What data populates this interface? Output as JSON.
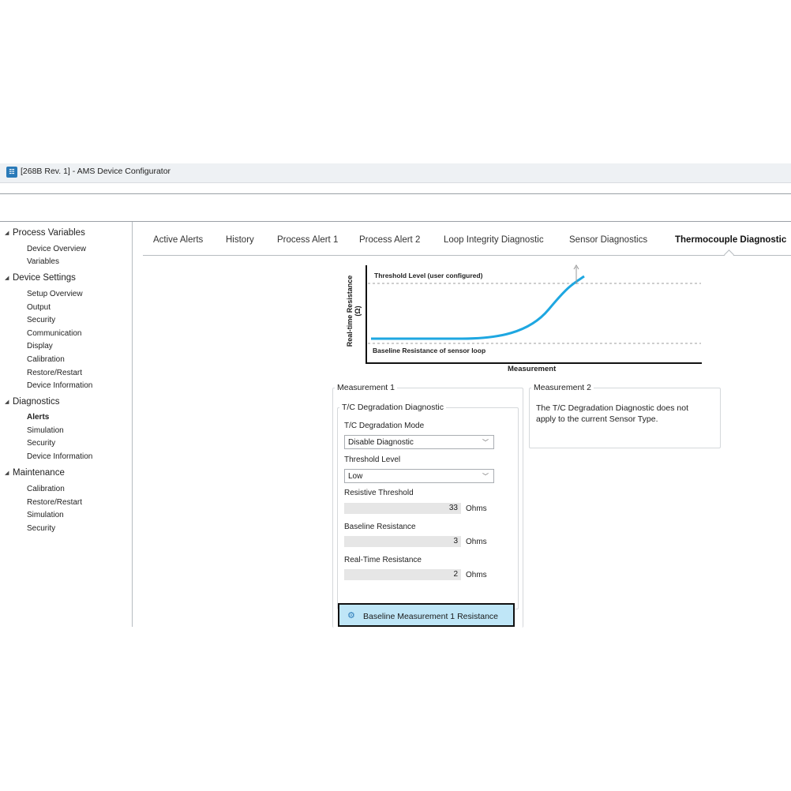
{
  "window": {
    "title": "[268B  Rev. 1] - AMS Device Configurator",
    "icon_name": "ams-app-icon",
    "icon_glyph": "☷"
  },
  "sidebar": {
    "groups": [
      {
        "label": "Process Variables",
        "items": [
          {
            "label": "Device Overview"
          },
          {
            "label": "Variables"
          }
        ]
      },
      {
        "label": "Device Settings",
        "items": [
          {
            "label": "Setup Overview"
          },
          {
            "label": "Output"
          },
          {
            "label": "Security"
          },
          {
            "label": "Communication"
          },
          {
            "label": "Display"
          },
          {
            "label": "Calibration"
          },
          {
            "label": "Restore/Restart"
          },
          {
            "label": "Device Information"
          }
        ]
      },
      {
        "label": "Diagnostics",
        "items": [
          {
            "label": "Alerts",
            "selected": true
          },
          {
            "label": "Simulation"
          },
          {
            "label": "Security"
          },
          {
            "label": "Device Information"
          }
        ]
      },
      {
        "label": "Maintenance",
        "items": [
          {
            "label": "Calibration"
          },
          {
            "label": "Restore/Restart"
          },
          {
            "label": "Simulation"
          },
          {
            "label": "Security"
          }
        ]
      }
    ]
  },
  "tabs": [
    {
      "label": "Active Alerts"
    },
    {
      "label": "History"
    },
    {
      "label": "Process Alert 1"
    },
    {
      "label": "Process Alert 2"
    },
    {
      "label": "Loop Integrity Diagnostic"
    },
    {
      "label": "Sensor Diagnostics"
    },
    {
      "label": "Thermocouple Diagnostic",
      "active": true
    }
  ],
  "diagram": {
    "threshold_label": "Threshold Level (user configured)",
    "baseline_label": "Baseline Resistance of sensor loop",
    "ylabel": "Real-time Resistance (Ω)",
    "xlabel": "Measurement",
    "curve_color": "#1ea7e1"
  },
  "measurement1": {
    "title": "Measurement 1",
    "section_title": "T/C Degradation Diagnostic",
    "mode_label": "T/C Degradation Mode",
    "mode_value": "Disable Diagnostic",
    "threshold_level_label": "Threshold Level",
    "threshold_level_value": "Low",
    "resistive_threshold_label": "Resistive Threshold",
    "resistive_threshold_value": "33",
    "baseline_resistance_label": "Baseline Resistance",
    "baseline_resistance_value": "3",
    "realtime_resistance_label": "Real-Time Resistance",
    "realtime_resistance_value": "2",
    "unit": "Ohms",
    "button_label": "Baseline Measurement 1 Resistance",
    "button_icon": "gear-icon"
  },
  "measurement2": {
    "title": "Measurement 2",
    "message": "The T/C Degradation Diagnostic does not apply to the current Sensor Type."
  },
  "colors": {
    "selected_button_bg": "#bfe6f7",
    "accent": "#2a7ab8"
  }
}
